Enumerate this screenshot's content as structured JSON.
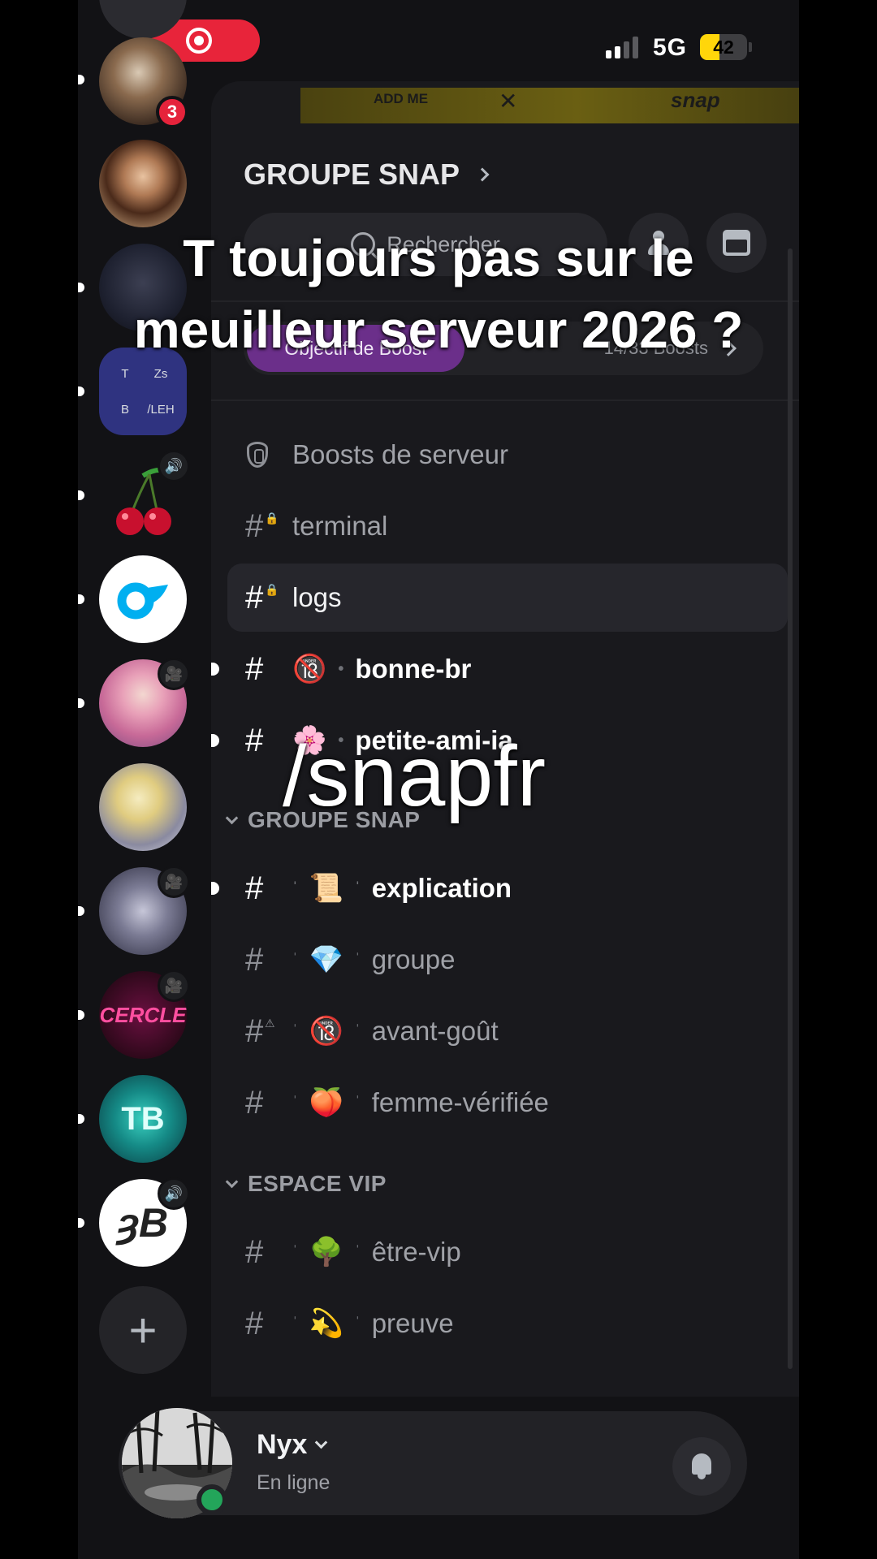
{
  "status_bar": {
    "network": "5G",
    "battery": "42",
    "battery_fraction": 0.42
  },
  "server_rail": {
    "notification_count": "3",
    "folder_tiles": [
      "T",
      "Zs",
      "B",
      "/LEH"
    ],
    "add_server_icon": "plus-icon"
  },
  "server": {
    "name": "GROUPE SNAP",
    "search_placeholder": "Rechercher",
    "boost_goal_label": "Objectif de Boost",
    "boost_count": "14/33 Boosts"
  },
  "channels": [
    {
      "label": "Boosts de serveur",
      "emoji": "",
      "icon": "shield-icon"
    },
    {
      "label": "terminal",
      "emoji": "",
      "icon": "hash-lock-icon"
    },
    {
      "label": "logs",
      "emoji": "",
      "icon": "hash-lock-icon"
    },
    {
      "label": "bonne-br",
      "emoji": "🔞",
      "icon": "hash-icon"
    },
    {
      "label": "petite-ami-ia",
      "emoji": "🌸",
      "icon": "hash-icon"
    }
  ],
  "categories": [
    {
      "name": "GROUPE SNAP",
      "channels": [
        {
          "label": "explication",
          "emoji": "📜"
        },
        {
          "label": "groupe",
          "emoji": "💎"
        },
        {
          "label": "avant-goût",
          "emoji": "🔞"
        },
        {
          "label": "femme-vérifiée",
          "emoji": "🍑"
        }
      ]
    },
    {
      "name": "ESPACE VIP",
      "channels": [
        {
          "label": "être-vip",
          "emoji": "🌳"
        },
        {
          "label": "preuve",
          "emoji": "💫"
        }
      ]
    }
  ],
  "user": {
    "name": "Nyx",
    "status": "En ligne"
  },
  "overlay": {
    "caption_line1": "T toujours pas sur le",
    "caption_line2": "meuilleur serveur 2026 ?",
    "tag": "/snapfr"
  },
  "colors": {
    "accent_boost": "#6b2f8a",
    "online": "#23a55a",
    "badge_red": "#e5233b",
    "battery_yellow": "#ffd60a",
    "rec_red": "#e8243a"
  }
}
